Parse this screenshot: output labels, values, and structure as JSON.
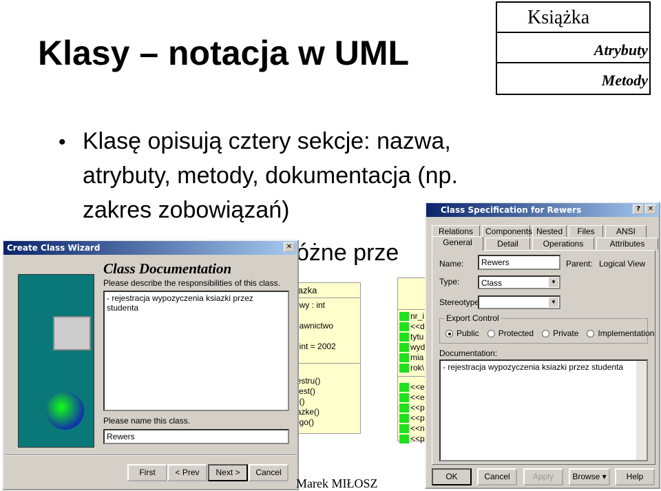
{
  "slide": {
    "title": "Klasy – notacja w UML",
    "bullets": [
      "Klasę opisują cztery sekcje: nazwa,",
      "atrybuty, metody, dokumentacja (np.",
      "zakres zobowiązań)"
    ],
    "bullet2_partial": "óżne prze",
    "footer": "Marek MIŁOSZ"
  },
  "class_box": {
    "name": "Książka",
    "attributes": "Atrybuty",
    "methods": "Metody"
  },
  "uml_class": {
    "name": "iazka",
    "attributes": [
      "owy : int",
      "",
      "dawnictwo",
      "r",
      ": int = 2002"
    ],
    "methods": [
      "jestru()",
      "Jest()",
      "e()",
      "iazke()",
      "ogo()"
    ]
  },
  "uml_class2": {
    "attributes": [
      "nr_i",
      "<<d",
      "tytu",
      "wyd",
      "mia",
      "rok\\"
    ],
    "methods": [
      "<<e",
      "<<e",
      "<<p",
      "<<p",
      "<<n",
      "<<p"
    ]
  },
  "wizard": {
    "title": "Create Class Wizard",
    "heading": "Class Documentation",
    "describe_label": "Please describe the responsibilities of this class.",
    "description": "- rejestracja wypozyczenia ksiazki przez studenta",
    "name_label": "Please name this class.",
    "name_value": "Rewers",
    "buttons": {
      "first": "First",
      "prev": "< Prev",
      "next": "Next >",
      "cancel": "Cancel"
    }
  },
  "spec": {
    "title": "Class Specification for Rewers",
    "tabs_row1": [
      "Relations",
      "Components",
      "Nested",
      "Files",
      "ANSI C++"
    ],
    "tabs_row2": [
      "General",
      "Detail",
      "Operations",
      "Attributes"
    ],
    "active_tab": "General",
    "name_label": "Name:",
    "name_value": "Rewers",
    "parent_label": "Parent:",
    "parent_value": "Logical View",
    "type_label": "Type:",
    "type_value": "Class",
    "stereotype_label": "Stereotype:",
    "stereotype_value": "",
    "export_label": "Export Control",
    "export_options": [
      "Public",
      "Protected",
      "Private",
      "Implementation"
    ],
    "export_selected": "Public",
    "doc_label": "Documentation:",
    "doc_value": "- rejestracja wypozyczenia ksiazki przez studenta",
    "buttons": {
      "ok": "OK",
      "cancel": "Cancel",
      "apply": "Apply",
      "browse": "Browse ▾",
      "help": "Help"
    }
  }
}
